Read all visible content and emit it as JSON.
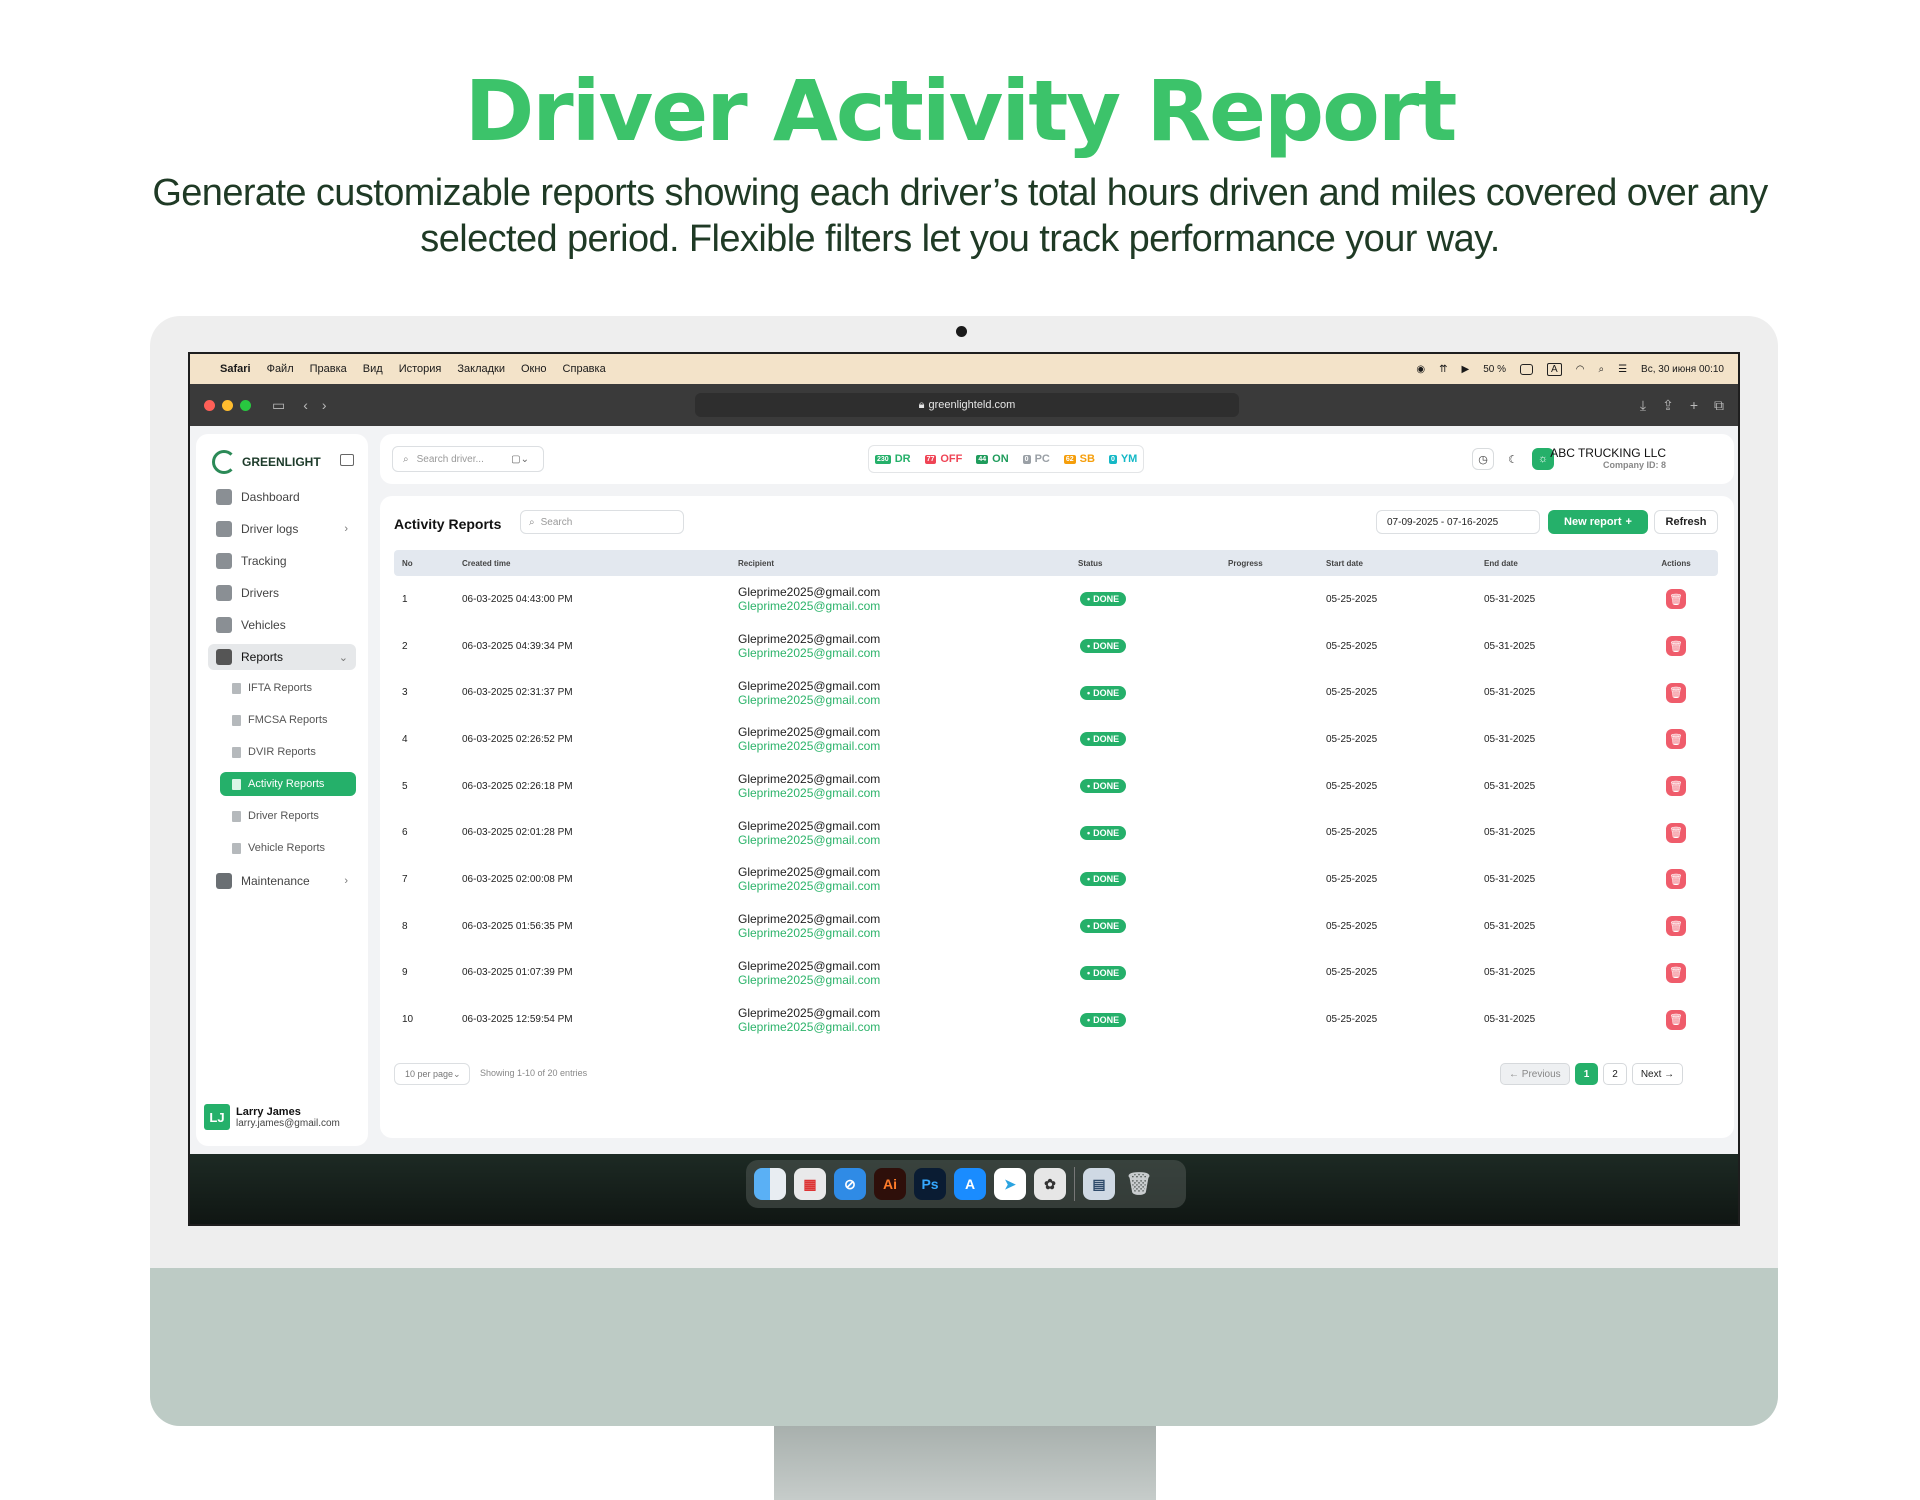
{
  "hero": {
    "title": "Driver Activity Report",
    "subtitle": "Generate customizable reports showing each driver’s total hours driven and miles covered over any selected period. Flexible filters let you track performance your way."
  },
  "menubar": {
    "app": "Safari",
    "items": [
      "Файл",
      "Правка",
      "Вид",
      "История",
      "Закладки",
      "Окно",
      "Справка"
    ],
    "battery": "50 %",
    "input": "A",
    "clock": "Вс, 30 июня  00:10"
  },
  "browser": {
    "url": "greenlighteld.com"
  },
  "sidebar": {
    "brand": "GREENLIGHT",
    "nav": [
      {
        "label": "Dashboard"
      },
      {
        "label": "Driver logs"
      },
      {
        "label": "Tracking"
      },
      {
        "label": "Drivers"
      },
      {
        "label": "Vehicles"
      },
      {
        "label": "Reports"
      }
    ],
    "reports_sub": [
      "IFTA Reports",
      "FMCSA Reports",
      "DVIR Reports",
      "Activity Reports",
      "Driver Reports",
      "Vehicle Reports"
    ],
    "maintenance": "Maintenance",
    "user": {
      "initials": "LJ",
      "name": "Larry James",
      "email": "larry.james@gmail.com"
    }
  },
  "topbar": {
    "search_placeholder": "Search driver...",
    "statuses": [
      {
        "count": "230",
        "label": "DR",
        "color": "#25b06a"
      },
      {
        "count": "77",
        "label": "OFF",
        "color": "#ef4455"
      },
      {
        "count": "44",
        "label": "ON",
        "color": "#1f9c5c"
      },
      {
        "count": "0",
        "label": "PC",
        "color": "#9aa0a6"
      },
      {
        "count": "62",
        "label": "SB",
        "color": "#f59e0b"
      },
      {
        "count": "0",
        "label": "YM",
        "color": "#14b8c6"
      }
    ],
    "company": "ABC TRUCKING LLC",
    "company_id": "Company ID: 8"
  },
  "panel": {
    "title": "Activity Reports",
    "search_placeholder": "Search",
    "date_range": "07-09-2025 - 07-16-2025",
    "new_report": "New report",
    "refresh": "Refresh",
    "columns": [
      "No",
      "Created time",
      "Recipient",
      "Status",
      "Progress",
      "Start date",
      "End date",
      "Actions"
    ],
    "rows": [
      {
        "no": "1",
        "created": "06-03-2025 04:43:00 PM",
        "recipient": "Gleprime2025@gmail.com",
        "recipient2": "Gleprime2025@gmail.com",
        "status": "DONE",
        "start": "05-25-2025",
        "end": "05-31-2025"
      },
      {
        "no": "2",
        "created": "06-03-2025 04:39:34 PM",
        "recipient": "Gleprime2025@gmail.com",
        "recipient2": "Gleprime2025@gmail.com",
        "status": "DONE",
        "start": "05-25-2025",
        "end": "05-31-2025"
      },
      {
        "no": "3",
        "created": "06-03-2025 02:31:37 PM",
        "recipient": "Gleprime2025@gmail.com",
        "recipient2": "Gleprime2025@gmail.com",
        "status": "DONE",
        "start": "05-25-2025",
        "end": "05-31-2025"
      },
      {
        "no": "4",
        "created": "06-03-2025 02:26:52 PM",
        "recipient": "Gleprime2025@gmail.com",
        "recipient2": "Gleprime2025@gmail.com",
        "status": "DONE",
        "start": "05-25-2025",
        "end": "05-31-2025"
      },
      {
        "no": "5",
        "created": "06-03-2025 02:26:18 PM",
        "recipient": "Gleprime2025@gmail.com",
        "recipient2": "Gleprime2025@gmail.com",
        "status": "DONE",
        "start": "05-25-2025",
        "end": "05-31-2025"
      },
      {
        "no": "6",
        "created": "06-03-2025 02:01:28 PM",
        "recipient": "Gleprime2025@gmail.com",
        "recipient2": "Gleprime2025@gmail.com",
        "status": "DONE",
        "start": "05-25-2025",
        "end": "05-31-2025"
      },
      {
        "no": "7",
        "created": "06-03-2025 02:00:08 PM",
        "recipient": "Gleprime2025@gmail.com",
        "recipient2": "Gleprime2025@gmail.com",
        "status": "DONE",
        "start": "05-25-2025",
        "end": "05-31-2025"
      },
      {
        "no": "8",
        "created": "06-03-2025 01:56:35 PM",
        "recipient": "Gleprime2025@gmail.com",
        "recipient2": "Gleprime2025@gmail.com",
        "status": "DONE",
        "start": "05-25-2025",
        "end": "05-31-2025"
      },
      {
        "no": "9",
        "created": "06-03-2025 01:07:39 PM",
        "recipient": "Gleprime2025@gmail.com",
        "recipient2": "Gleprime2025@gmail.com",
        "status": "DONE",
        "start": "05-25-2025",
        "end": "05-31-2025"
      },
      {
        "no": "10",
        "created": "06-03-2025 12:59:54 PM",
        "recipient": "Gleprime2025@gmail.com",
        "recipient2": "Gleprime2025@gmail.com",
        "status": "DONE",
        "start": "05-25-2025",
        "end": "05-31-2025"
      }
    ],
    "per_page": "10 per page",
    "showing": "Showing 1-10 of 20 entries",
    "pagination": {
      "previous": "← Previous",
      "pages": [
        "1",
        "2"
      ],
      "next": "Next →"
    }
  },
  "dock": [
    "finder-icon",
    "launchpad-icon",
    "safari-icon",
    "Ai",
    "Ps",
    "app-store-icon",
    "telegram-icon",
    "chatgpt-icon",
    "preview-icon",
    "trash-icon"
  ]
}
